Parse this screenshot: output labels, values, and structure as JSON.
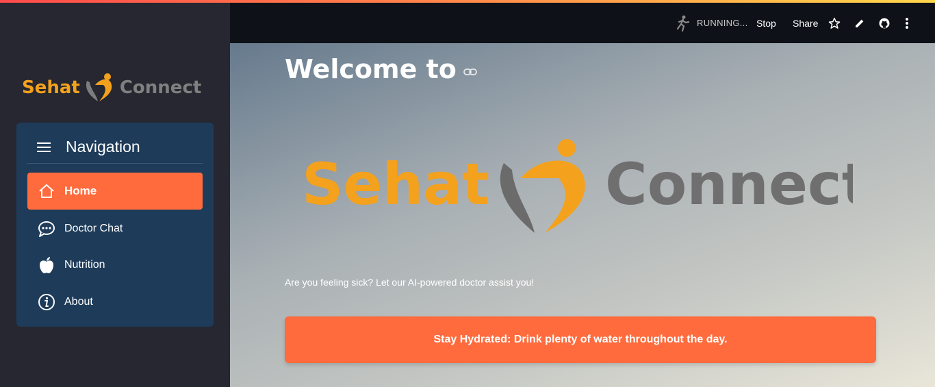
{
  "app": {
    "brand_part1": "Sehat",
    "brand_part2": "Connect"
  },
  "header": {
    "status": "RUNNING...",
    "stop_label": "Stop",
    "share_label": "Share",
    "icons": [
      "running-man-icon",
      "star-icon",
      "pencil-icon",
      "github-icon",
      "kebab-menu-icon"
    ]
  },
  "sidebar": {
    "nav_title": "Navigation",
    "items": [
      {
        "label": "Home",
        "icon": "home-icon",
        "active": true
      },
      {
        "label": "Doctor Chat",
        "icon": "chat-bubble-icon",
        "active": false
      },
      {
        "label": "Nutrition",
        "icon": "apple-icon",
        "active": false
      },
      {
        "label": "About",
        "icon": "info-icon",
        "active": false
      }
    ]
  },
  "main": {
    "heading": "Welcome to",
    "hero_brand_part1": "Sehat",
    "hero_brand_part2": "Connect",
    "tagline": "Are you feeling sick? Let our AI-powered doctor assist you!",
    "tip": "Stay Hydrated: Drink plenty of water throughout the day."
  },
  "colors": {
    "accent": "#ff6b3d",
    "brand_orange": "#f4a11d",
    "brand_gray": "#808080",
    "sidebar_bg": "#262730",
    "nav_panel": "#1e3c5a",
    "header_bg": "#0e1117"
  }
}
